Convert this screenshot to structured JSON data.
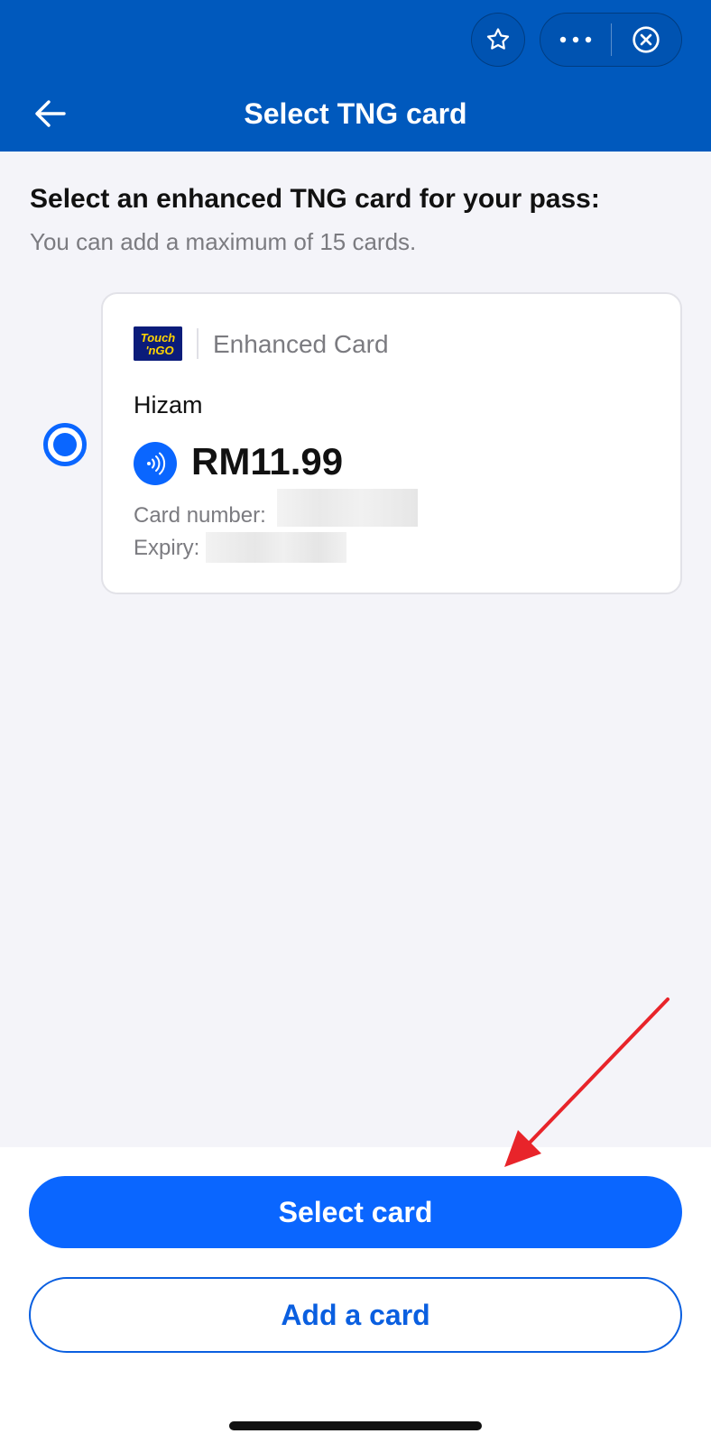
{
  "header": {
    "title": "Select TNG card",
    "color": "#0059bd"
  },
  "content": {
    "heading": "Select an enhanced TNG card for your pass:",
    "subheading": "You can add a maximum of 15 cards."
  },
  "card": {
    "logo_text_top": "Touch",
    "logo_text_bottom": "'nGO",
    "type": "Enhanced Card",
    "holder": "Hizam",
    "balance": "RM11.99",
    "card_number_label": "Card number:",
    "expiry_label": "Expiry:",
    "selected": true
  },
  "buttons": {
    "select_label": "Select card",
    "add_label": "Add a card"
  },
  "colors": {
    "accent": "#0a66ff",
    "annotation_arrow": "#e8242a"
  },
  "icons": [
    "star-icon",
    "more-icon",
    "close-circle-icon",
    "back-arrow-icon",
    "nfc-icon"
  ]
}
